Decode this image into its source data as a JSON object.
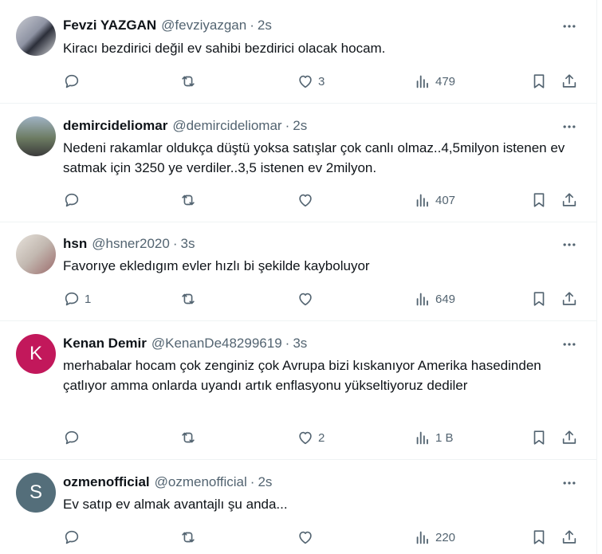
{
  "tweets": [
    {
      "name": "Fevzi YAZGAN",
      "handle": "@fevziyazgan",
      "time": "2s",
      "text": "Kiracı bezdirici değil ev sahibi bezdirici olacak hocam.",
      "replies": "",
      "likes": "3",
      "views": "479"
    },
    {
      "name": "demircideliomar",
      "handle": "@demircideliomar",
      "time": "2s",
      "text": "Nedeni rakamlar oldukça düştü yoksa satışlar çok canlı olmaz..4,5milyon istenen ev satmak için 3250 ye verdiler..3,5 istenen ev 2milyon.",
      "replies": "",
      "likes": "",
      "views": "407"
    },
    {
      "name": "hsn",
      "handle": "@hsner2020",
      "time": "3s",
      "text": "Favorıye ekledıgım evler hızlı bi şekilde kayboluyor",
      "replies": "1",
      "likes": "",
      "views": "649"
    },
    {
      "name": "Kenan Demir",
      "handle": "@KenanDe48299619",
      "time": "3s",
      "avatar_letter": "K",
      "text": "merhabalar hocam çok zenginiz çok Avrupa bizi kıskanıyor Amerika hasedinden çatlıyor amma onlarda uyandı artık enflasyonu yükseltiyoruz dediler",
      "replies": "",
      "likes": "2",
      "views": "1 B"
    },
    {
      "name": "ozmenofficial",
      "handle": "@ozmenofficial",
      "time": "2s",
      "avatar_letter": "S",
      "text": "Ev satıp ev almak avantajlı şu anda...",
      "replies": "",
      "likes": "",
      "views": "220"
    }
  ],
  "separator": "·",
  "icons": {
    "more": "more-dots-icon",
    "reply": "reply-bubble-icon",
    "retweet": "retweet-icon",
    "like": "heart-icon",
    "views": "views-bar-chart-icon",
    "bookmark": "bookmark-icon",
    "share": "share-upload-icon"
  },
  "colors": {
    "text": "#0f1419",
    "secondary": "#536471",
    "border": "#eff3f4",
    "avatar_k": "#c2185b",
    "avatar_s": "#546e7a"
  }
}
